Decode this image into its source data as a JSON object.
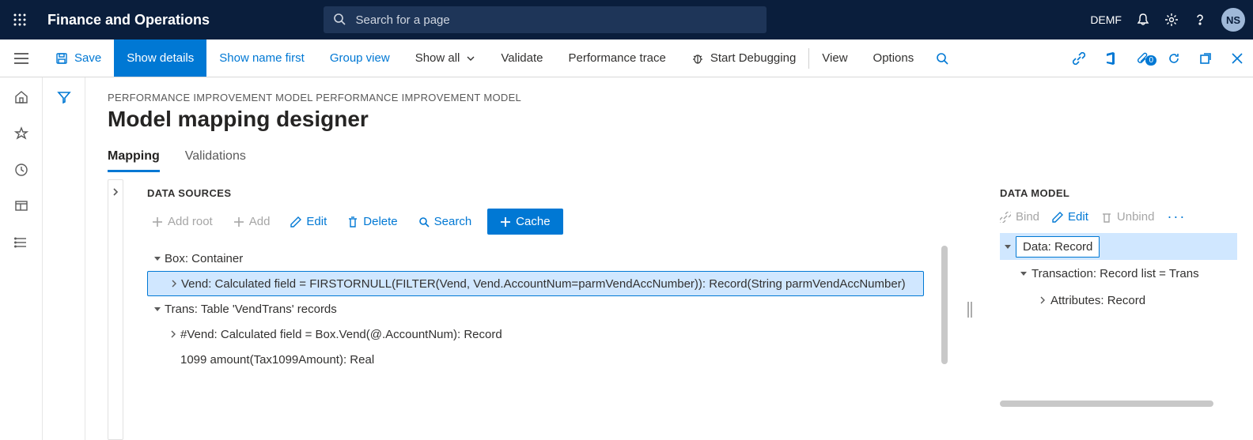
{
  "header": {
    "brand": "Finance and Operations",
    "search_placeholder": "Search for a page",
    "company": "DEMF",
    "user_initials": "NS"
  },
  "ribbon": {
    "save": "Save",
    "show_details": "Show details",
    "show_name_first": "Show name first",
    "group_view": "Group view",
    "show_all": "Show all",
    "validate": "Validate",
    "perf_trace": "Performance trace",
    "start_debug": "Start Debugging",
    "view": "View",
    "options": "Options",
    "badge": "0"
  },
  "page": {
    "crumb": "PERFORMANCE IMPROVEMENT MODEL PERFORMANCE IMPROVEMENT MODEL",
    "title": "Model mapping designer"
  },
  "tabs": {
    "mapping": "Mapping",
    "validations": "Validations"
  },
  "ds": {
    "title": "DATA SOURCES",
    "add_root": "Add root",
    "add": "Add",
    "edit": "Edit",
    "delete": "Delete",
    "search": "Search",
    "cache": "Cache",
    "tree": {
      "box": "Box: Container",
      "vend": "Vend: Calculated field = FIRSTORNULL(FILTER(Vend, Vend.AccountNum=parmVendAccNumber)): Record(String parmVendAccNumber)",
      "trans": "Trans: Table 'VendTrans' records",
      "nvend": "#Vend: Calculated field = Box.Vend(@.AccountNum): Record",
      "amount": "1099 amount(Tax1099Amount): Real"
    }
  },
  "dm": {
    "title": "DATA MODEL",
    "bind": "Bind",
    "edit": "Edit",
    "unbind": "Unbind",
    "tree": {
      "data": "Data: Record",
      "trans": "Transaction: Record list = Trans",
      "attrs": "Attributes: Record"
    }
  }
}
